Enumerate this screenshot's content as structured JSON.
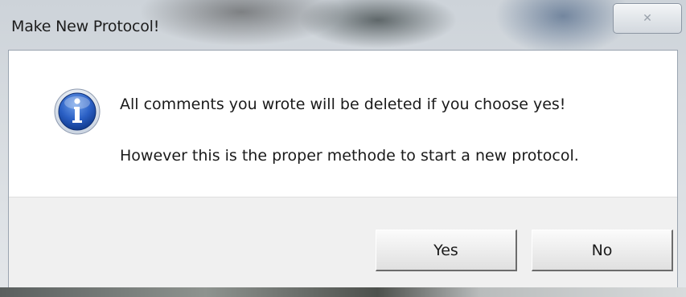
{
  "window": {
    "title": "Make New Protocol!",
    "close_glyph": "✕"
  },
  "dialog": {
    "icon": "info-icon",
    "message_line1": "All comments you wrote will be deleted if you choose yes!",
    "message_line2": "However this is the proper methode to start a new protocol."
  },
  "buttons": {
    "yes_label": "Yes",
    "no_label": "No"
  },
  "colors": {
    "info_icon_blue": "#1f56b8",
    "button_face": "#ececec",
    "dialog_background": "#ffffff"
  }
}
